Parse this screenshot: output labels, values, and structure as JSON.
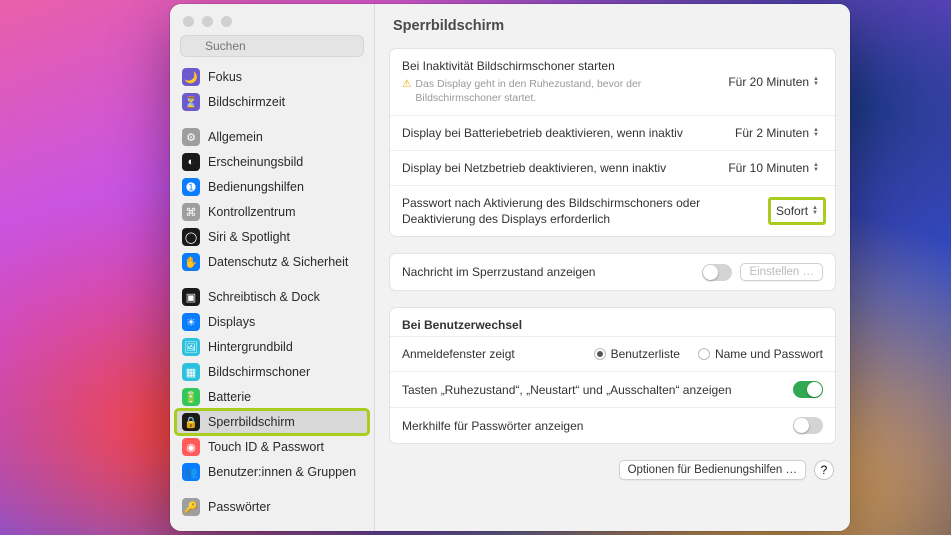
{
  "window": {
    "title": "Sperrbildschirm"
  },
  "search": {
    "placeholder": "Suchen"
  },
  "sidebar": {
    "groups": [
      [
        {
          "label": "Fokus",
          "icon": "🌙",
          "bg": "#6e5acf"
        },
        {
          "label": "Bildschirmzeit",
          "icon": "⏳",
          "bg": "#6e5acf"
        }
      ],
      [
        {
          "label": "Allgemein",
          "icon": "⚙",
          "bg": "#9e9e9e"
        },
        {
          "label": "Erscheinungsbild",
          "icon": "◐",
          "bg": "#1a1a1a"
        },
        {
          "label": "Bedienungshilfen",
          "icon": "➊",
          "bg": "#0a7cff"
        },
        {
          "label": "Kontrollzentrum",
          "icon": "⌘",
          "bg": "#9e9e9e"
        },
        {
          "label": "Siri & Spotlight",
          "icon": "◯",
          "bg": "#1a1a1a"
        },
        {
          "label": "Datenschutz & Sicherheit",
          "icon": "✋",
          "bg": "#0a7cff"
        }
      ],
      [
        {
          "label": "Schreibtisch & Dock",
          "icon": "▣",
          "bg": "#1a1a1a"
        },
        {
          "label": "Displays",
          "icon": "☀",
          "bg": "#0a7cff"
        },
        {
          "label": "Hintergrundbild",
          "icon": "🖼",
          "bg": "#2dc1e0"
        },
        {
          "label": "Bildschirmschoner",
          "icon": "▦",
          "bg": "#2dc1e0"
        },
        {
          "label": "Batterie",
          "icon": "🔋",
          "bg": "#34c759"
        },
        {
          "label": "Sperrbildschirm",
          "icon": "🔒",
          "bg": "#1a1a1a",
          "selected": true,
          "highlight": true
        },
        {
          "label": "Touch ID & Passwort",
          "icon": "◉",
          "bg": "#ff5b5b"
        },
        {
          "label": "Benutzer:innen & Gruppen",
          "icon": "👥",
          "bg": "#0a7cff"
        }
      ],
      [
        {
          "label": "Passwörter",
          "icon": "🔑",
          "bg": "#9e9e9e"
        }
      ]
    ]
  },
  "settings": {
    "screensaver": {
      "label": "Bei Inaktivität Bildschirmschoner starten",
      "value": "Für 20 Minuten",
      "warning": "Das Display geht in den Ruhezustand, bevor der Bildschirmschoner startet."
    },
    "display_battery": {
      "label": "Display bei Batteriebetrieb deaktivieren, wenn inaktiv",
      "value": "Für 2 Minuten"
    },
    "display_power": {
      "label": "Display bei Netzbetrieb deaktivieren, wenn inaktiv",
      "value": "Für 10 Minuten"
    },
    "require_password": {
      "label": "Passwort nach Aktivierung des Bildschirmschoners oder Deaktivierung des Displays erforderlich",
      "value": "Sofort",
      "highlight": true
    },
    "lock_message": {
      "label": "Nachricht im Sperrzustand anzeigen",
      "on": false,
      "button": "Einstellen …"
    },
    "user_switch": {
      "title": "Bei Benutzerwechsel",
      "login_window": {
        "label": "Anmeldefenster zeigt",
        "option_list": "Benutzerliste",
        "option_namepw": "Name und Passwort",
        "selected": "list"
      },
      "show_buttons": {
        "label": "Tasten „Ruhezustand“, „Neustart“ und „Ausschalten“ anzeigen",
        "on": true
      },
      "password_hints": {
        "label": "Merkhilfe für Passwörter anzeigen",
        "on": false
      }
    },
    "footer": {
      "accessibility": "Optionen für Bedienungshilfen …",
      "help": "?"
    }
  }
}
